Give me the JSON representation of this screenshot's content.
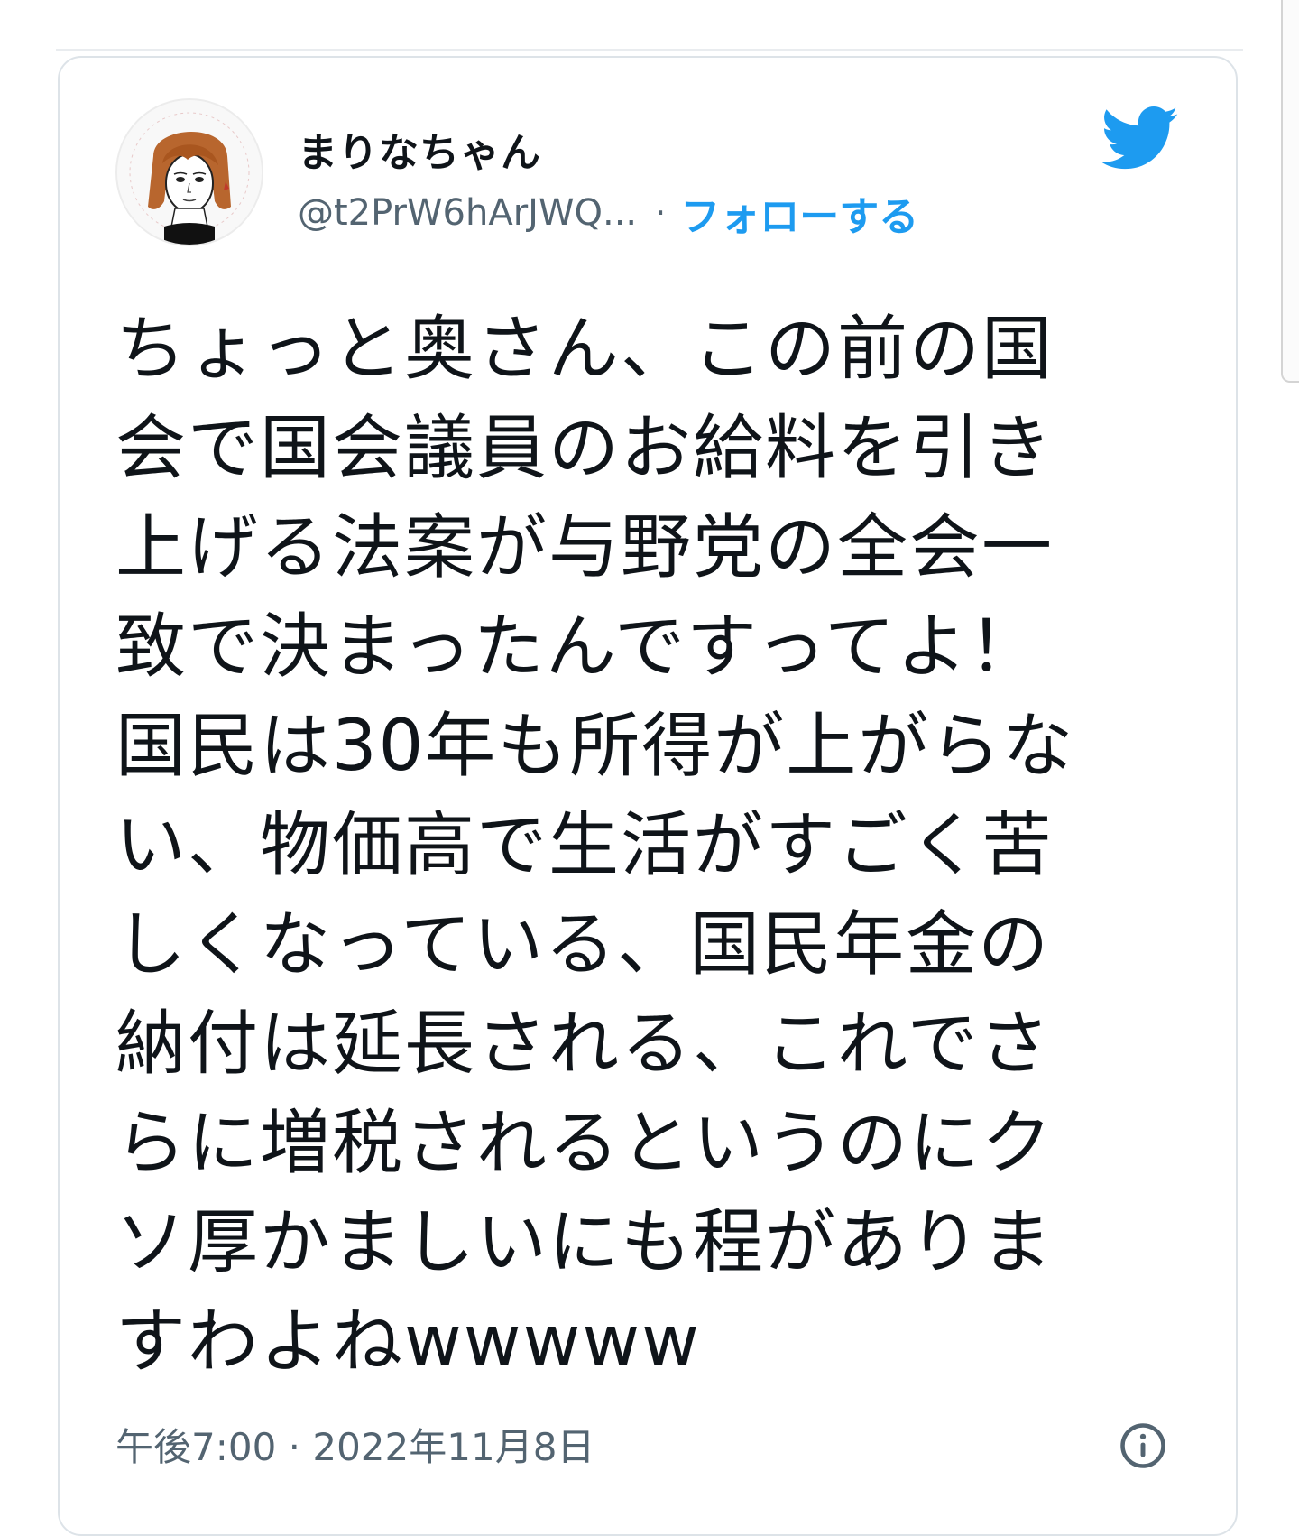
{
  "tweet": {
    "author": {
      "display_name": "まりなちゃん",
      "handle": "@t2PrW6hArJWQ...",
      "separator": "·",
      "follow_label": "フォローする",
      "avatar_icon": "avatar-illustration"
    },
    "platform_icon": "twitter-bird-icon",
    "text_lines": [
      "ちょっと奥さん、この前の国",
      "会で国会議員のお給料を引き",
      "上げる法案が与野党の全会一",
      "致で決まったんですってよ！",
      "国民は30年も所得が上がらな",
      "い、物価高で生活がすごく苦",
      "しくなっている、国民年金の",
      "納付は延長される、これでさ",
      "らに増税されるというのにク",
      "ソ厚かましいにも程がありま",
      "すわよねwwwww"
    ],
    "timestamp": "午後7:00 · 2022年11月8日",
    "info_icon": "info-icon"
  },
  "colors": {
    "accent": "#1d9bf0",
    "text": "#0f1419",
    "secondary_text": "#536471",
    "border": "#dde3e8"
  }
}
